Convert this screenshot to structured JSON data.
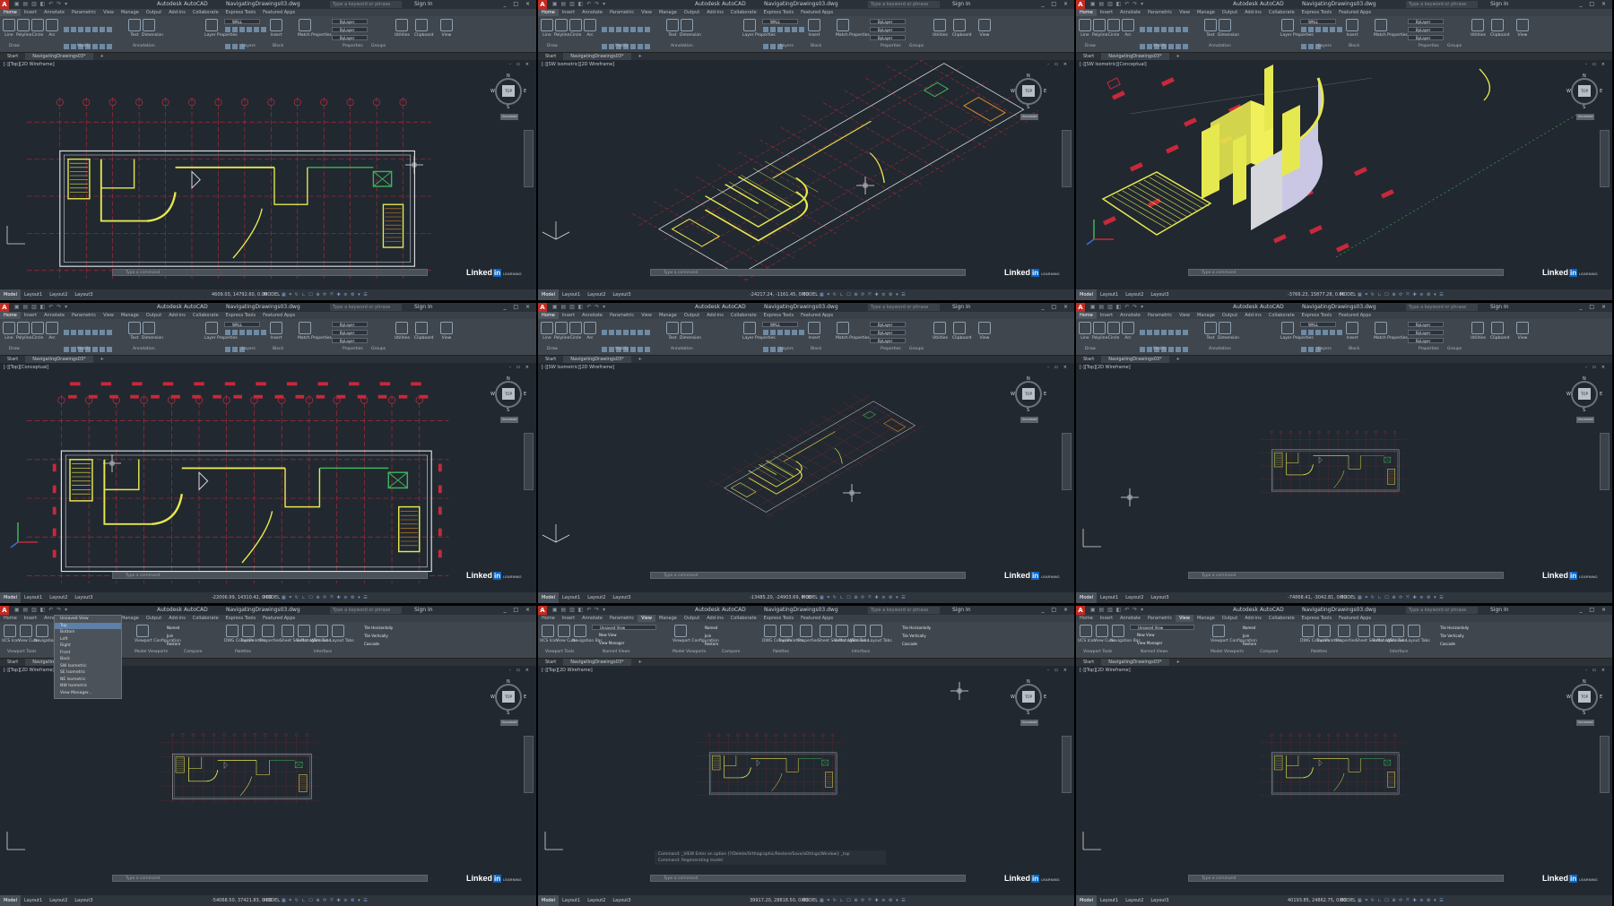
{
  "app": {
    "logo": "A",
    "title": "Autodesk AutoCAD",
    "file": "NavigatingDrawings03.dwg",
    "search_placeholder": "Type a keyword or phrase",
    "sign_in": "Sign In",
    "win_buttons": "_ □ ×"
  },
  "ribbon_tabs": [
    "Home",
    "Insert",
    "Annotate",
    "Parametric",
    "View",
    "Manage",
    "Output",
    "Add-ins",
    "Collaborate",
    "Express Tools",
    "Featured Apps"
  ],
  "home_tools": [
    "Line",
    "Polyline",
    "Circle",
    "Arc",
    "Text",
    "Dimension",
    "Layer Properties",
    "Insert",
    "Match Properties",
    "Utilities",
    "Clipboard",
    "View"
  ],
  "home_groups": [
    "Draw",
    "Modify",
    "Annotation",
    "Layers",
    "Block",
    "Properties",
    "Groups"
  ],
  "layer_name": "WALL",
  "bylayer": "ByLayer",
  "view_tools": [
    "UCS Icon",
    "View Cube",
    "Navigation Bar",
    "Viewport Configuration",
    "Named",
    "Join",
    "Restore",
    "DWG Compare",
    "Tool Palettes",
    "Properties",
    "Sheet Set Manager",
    "Switch Windows",
    "File Tabs",
    "Layout Tabs",
    "Tile Horizontally",
    "Tile Vertically",
    "Cascade"
  ],
  "view_groups": [
    "Viewport Tools",
    "Model Viewports",
    "Named Views",
    "Compare",
    "Palettes",
    "Interface"
  ],
  "views_dropdown": {
    "current": "Unsaved View",
    "items": [
      "Unsaved View",
      "Top",
      "Bottom",
      "Left",
      "Right",
      "Front",
      "Back",
      "SW Isometric",
      "SE Isometric",
      "NE Isometric",
      "NW Isometric",
      "View Manager..."
    ]
  },
  "named_views_small": [
    "New View",
    "View Manager"
  ],
  "doc_tabs": {
    "start": "Start",
    "file": "NavigatingDrawings03*"
  },
  "layout_tabs": [
    "Model",
    "Layout1",
    "Layout2",
    "Layout3"
  ],
  "command_placeholder": "Type a command",
  "command_history": [
    "Command: _VIEW Enter an option [?/Delete/Orthographic/Restore/Save/sEttings/Window]: _top",
    "Command: Regenerating model."
  ],
  "cube": {
    "n": "N",
    "s": "S",
    "w": "W",
    "e": "E",
    "top": "TOP",
    "wcs": "Unnamed"
  },
  "watermark": {
    "name": "Linked",
    "in": "in",
    "sub": "LEARNING"
  },
  "panels": [
    {
      "id": "p1",
      "label": "[-][Top][2D Wireframe]",
      "coord": "4609.03, 14792.60, 0.00",
      "mode": "MODEL"
    },
    {
      "id": "p2",
      "label": "[-][SW Isometric][2D Wireframe]",
      "coord": "-24217.24, -1161.45, 0.00",
      "mode": "MODEL"
    },
    {
      "id": "p3",
      "label": "[-][SW Isometric][Conceptual]",
      "coord": "-3766.23, 15877.28, 0.00",
      "mode": "MODEL"
    },
    {
      "id": "p4",
      "label": "[-][Top][Conceptual]",
      "coord": "-22006.99, 14310.42, 0.00",
      "mode": "MODEL"
    },
    {
      "id": "p5",
      "label": "[-][SW Isometric][2D Wireframe]",
      "coord": "-13485.20, -24903.69, 0.00",
      "mode": "MODEL"
    },
    {
      "id": "p6",
      "label": "[-][Top][2D Wireframe]",
      "coord": "-74868.41, -3042.81, 0.00",
      "mode": "MODEL"
    },
    {
      "id": "p7",
      "label": "[-][Top][2D Wireframe]",
      "coord": "-54068.50, 37421.83, 0.00",
      "mode": "MODEL"
    },
    {
      "id": "p8",
      "label": "[-][Top][2D Wireframe]",
      "coord": "39917.20, 28818.50, 0.00",
      "mode": "MODEL"
    },
    {
      "id": "p9",
      "label": "[-][Top][2D Wireframe]",
      "coord": "40193.85, 24862.75, 0.00",
      "mode": "MODEL"
    }
  ],
  "colors": {
    "bg": "#212830",
    "red": "#c8283a",
    "yellow": "#e6e84f",
    "white": "#dfe3e6",
    "green": "#3fb45a"
  }
}
